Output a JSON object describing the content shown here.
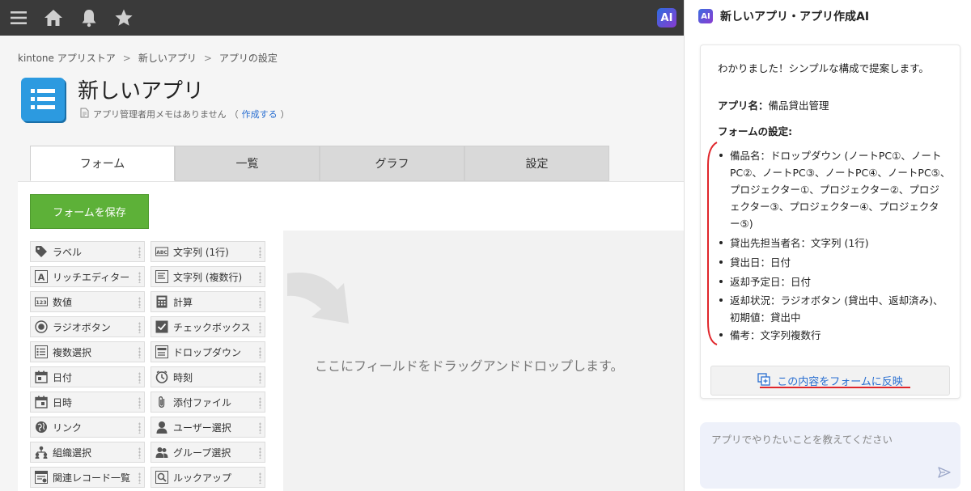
{
  "topbar": {
    "icons": [
      "menu-icon",
      "home-icon",
      "bell-icon",
      "star-icon"
    ],
    "ai_badge": "AI"
  },
  "breadcrumb": [
    "kintone アプリストア",
    "新しいアプリ",
    "アプリの設定"
  ],
  "app": {
    "title": "新しいアプリ",
    "memo_text": "アプリ管理者用メモはありません",
    "memo_link": "作成する",
    "memo_paren_open": "（",
    "memo_paren_close": "）"
  },
  "tabs": [
    {
      "label": "フォーム",
      "active": true
    },
    {
      "label": "一覧",
      "active": false
    },
    {
      "label": "グラフ",
      "active": false
    },
    {
      "label": "設定",
      "active": false
    }
  ],
  "form": {
    "save_label": "フォームを保存",
    "dropzone_text": "ここにフィールドをドラッグアンドドロップします。"
  },
  "palette": [
    {
      "label": "ラベル",
      "icon": "tag-icon"
    },
    {
      "label": "文字列 (1行)",
      "icon": "abc-icon"
    },
    {
      "label": "リッチエディター",
      "icon": "rich-text-icon"
    },
    {
      "label": "文字列 (複数行)",
      "icon": "multiline-text-icon"
    },
    {
      "label": "数値",
      "icon": "number-icon"
    },
    {
      "label": "計算",
      "icon": "calculator-icon"
    },
    {
      "label": "ラジオボタン",
      "icon": "radio-icon"
    },
    {
      "label": "チェックボックス",
      "icon": "checkbox-icon"
    },
    {
      "label": "複数選択",
      "icon": "multi-select-icon"
    },
    {
      "label": "ドロップダウン",
      "icon": "dropdown-icon"
    },
    {
      "label": "日付",
      "icon": "calendar-icon"
    },
    {
      "label": "時刻",
      "icon": "clock-icon"
    },
    {
      "label": "日時",
      "icon": "datetime-icon"
    },
    {
      "label": "添付ファイル",
      "icon": "paperclip-icon"
    },
    {
      "label": "リンク",
      "icon": "globe-icon"
    },
    {
      "label": "ユーザー選択",
      "icon": "user-icon"
    },
    {
      "label": "組織選択",
      "icon": "org-icon"
    },
    {
      "label": "グループ選択",
      "icon": "group-icon"
    },
    {
      "label": "関連レコード一覧",
      "icon": "related-records-icon"
    },
    {
      "label": "ルックアップ",
      "icon": "lookup-icon"
    }
  ],
  "ai": {
    "badge": "AI",
    "title": "新しいアプリ・アプリ作成AI",
    "intro": "わかりました！シンプルな構成で提案します。",
    "app_name_label": "アプリ名：",
    "app_name_value": "備品貸出管理",
    "form_settings_label": "フォームの設定:",
    "items": [
      "備品名：ドロップダウン (ノートPC①、ノート\nPC②、ノートPC③、ノートPC④、ノートPC⑤、\nプロジェクター①、プロジェクター②、プロジ\nェクター③、プロジェクター④、プロジェクタ\nー⑤)",
      "貸出先担当者名：文字列 (1行)",
      "貸出日：日付",
      "返却予定日：日付",
      "返却状況：ラジオボタン (貸出中、返却済み)、\n初期値：貸出中",
      "備考：文字列複数行"
    ],
    "reflect_label": "この内容をフォームに反映",
    "input_placeholder": "アプリでやりたいことを教えてください",
    "accent_color": "#e0262b",
    "link_color": "#2a6fd1"
  }
}
